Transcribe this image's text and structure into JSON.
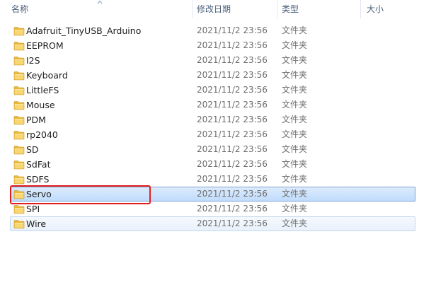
{
  "columns": {
    "name": "名称",
    "date_modified": "修改日期",
    "type": "类型",
    "size": "大小"
  },
  "sort": {
    "column": "name",
    "direction": "ascending",
    "icon": "sort-up-arrow-icon"
  },
  "icons": {
    "folder": "folder-icon"
  },
  "colors": {
    "selection_fill": "#c9e0fc",
    "selection_border": "#7da2ce",
    "annotation": "#e02020"
  },
  "files": [
    {
      "name": "Adafruit_TinyUSB_Arduino",
      "date": "2021/11/2 23:56",
      "type": "文件夹"
    },
    {
      "name": "EEPROM",
      "date": "2021/11/2 23:56",
      "type": "文件夹"
    },
    {
      "name": "I2S",
      "date": "2021/11/2 23:56",
      "type": "文件夹"
    },
    {
      "name": "Keyboard",
      "date": "2021/11/2 23:56",
      "type": "文件夹"
    },
    {
      "name": "LittleFS",
      "date": "2021/11/2 23:56",
      "type": "文件夹"
    },
    {
      "name": "Mouse",
      "date": "2021/11/2 23:56",
      "type": "文件夹"
    },
    {
      "name": "PDM",
      "date": "2021/11/2 23:56",
      "type": "文件夹"
    },
    {
      "name": "rp2040",
      "date": "2021/11/2 23:56",
      "type": "文件夹"
    },
    {
      "name": "SD",
      "date": "2021/11/2 23:56",
      "type": "文件夹"
    },
    {
      "name": "SdFat",
      "date": "2021/11/2 23:56",
      "type": "文件夹"
    },
    {
      "name": "SDFS",
      "date": "2021/11/2 23:56",
      "type": "文件夹"
    },
    {
      "name": "Servo",
      "date": "2021/11/2 23:56",
      "type": "文件夹",
      "state": "selected"
    },
    {
      "name": "SPI",
      "date": "2021/11/2 23:56",
      "type": "文件夹"
    },
    {
      "name": "Wire",
      "date": "2021/11/2 23:56",
      "type": "文件夹",
      "state": "hover"
    }
  ],
  "annotation": {
    "target": "Servo"
  }
}
